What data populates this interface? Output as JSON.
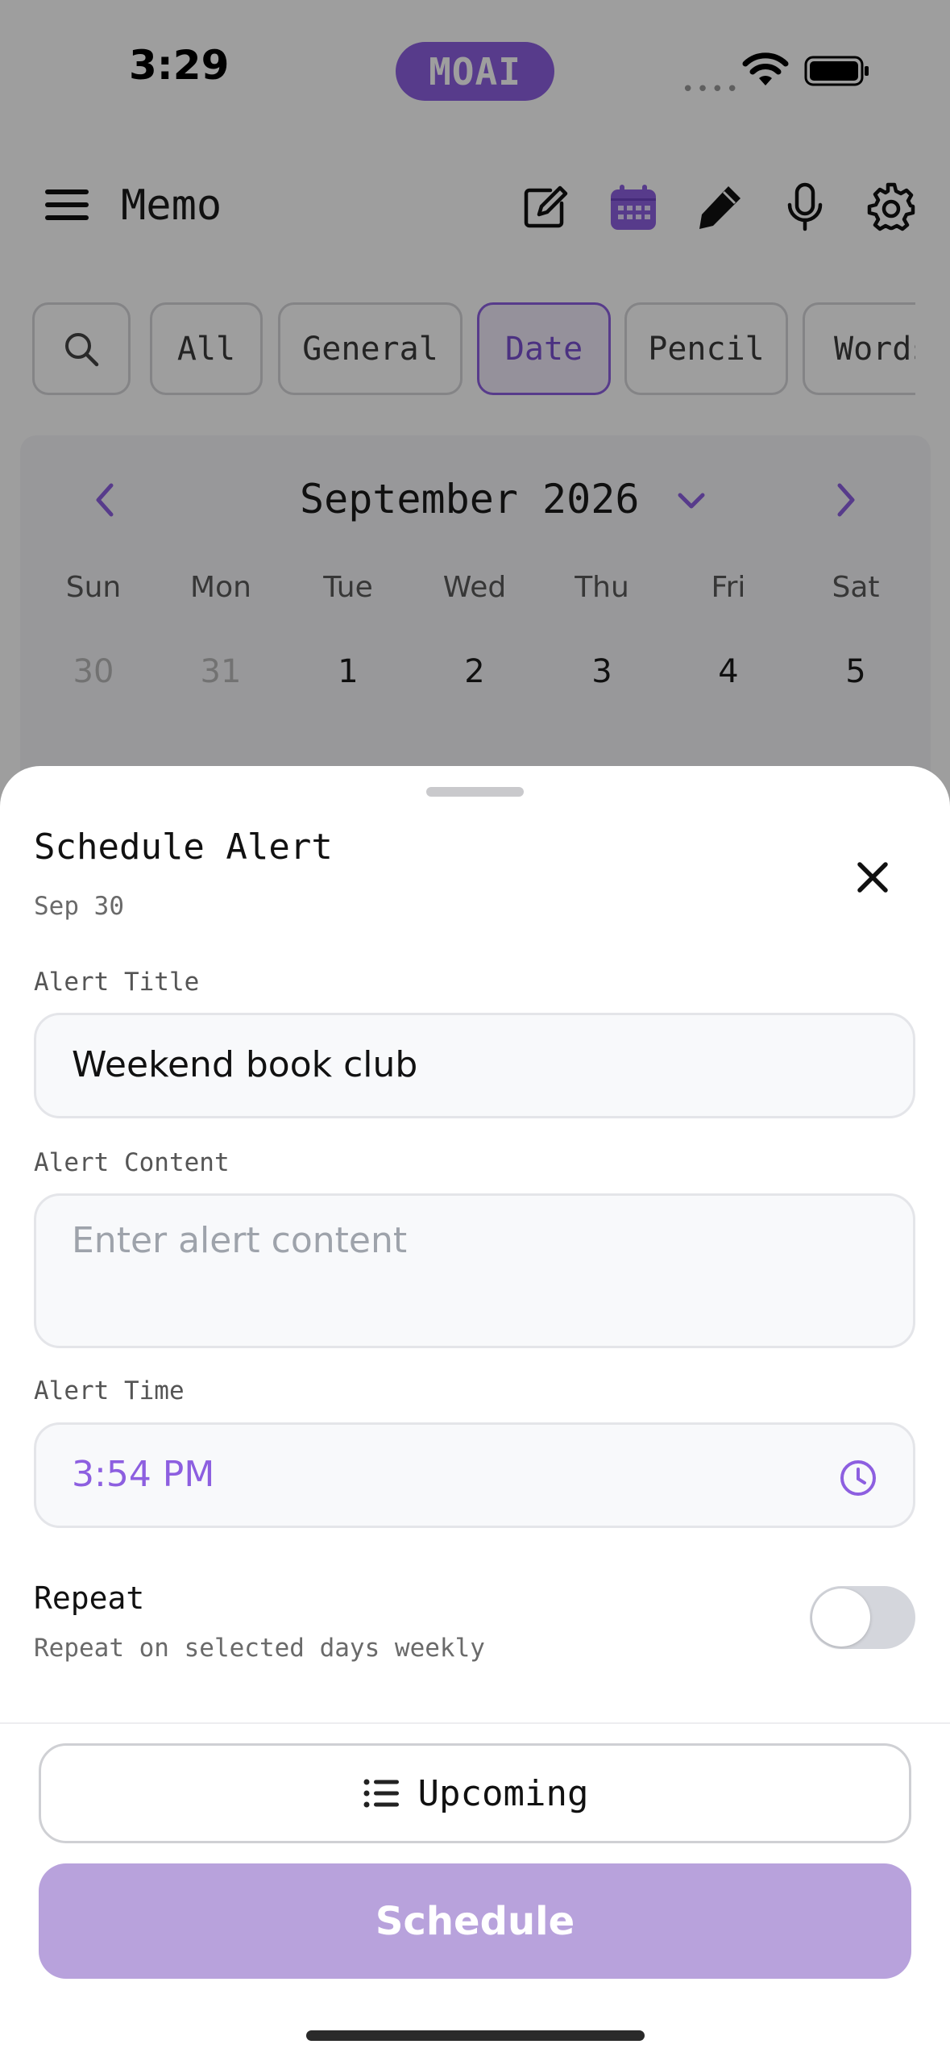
{
  "status_bar": {
    "time": "3:29",
    "brand": "MOAI",
    "signal": "••••"
  },
  "header": {
    "title": "Memo"
  },
  "filters": {
    "items": [
      {
        "label": "All"
      },
      {
        "label": "General"
      },
      {
        "label": "Date"
      },
      {
        "label": "Pencil"
      },
      {
        "label": "Words"
      }
    ],
    "active": "Date"
  },
  "calendar": {
    "month_label": "September 2026",
    "weekdays": [
      "Sun",
      "Mon",
      "Tue",
      "Wed",
      "Thu",
      "Fri",
      "Sat"
    ],
    "days": [
      "30",
      "31",
      "1",
      "2",
      "3",
      "4",
      "5"
    ]
  },
  "sheet": {
    "title": "Schedule Alert",
    "date": "Sep 30",
    "alert_title_label": "Alert Title",
    "alert_title_value": "Weekend book club",
    "alert_content_label": "Alert Content",
    "alert_content_placeholder": "Enter alert content",
    "alert_time_label": "Alert Time",
    "alert_time_value": "3:54 PM",
    "repeat_title": "Repeat",
    "repeat_sub": "Repeat on selected days weekly",
    "repeat_enabled": false,
    "upcoming_label": "Upcoming",
    "schedule_label": "Schedule"
  },
  "colors": {
    "accent": "#8d5fe0",
    "schedule_button": "#b8a2dc"
  }
}
